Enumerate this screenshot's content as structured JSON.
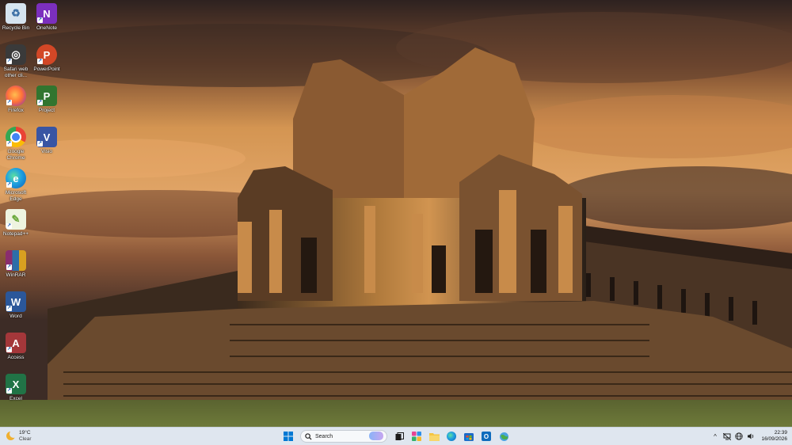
{
  "desktop": {
    "icons": [
      {
        "label": "Recycle Bin",
        "icon": "recycle-bin-icon",
        "color": "#d6e4f0",
        "glyph": "♻"
      },
      {
        "label": "OneNote",
        "icon": "onenote-icon",
        "color": "#7b2fbe",
        "glyph": "N"
      },
      {
        "label": "Safari web other cli...",
        "icon": "safari-app-icon",
        "color": "#3a3a3a",
        "glyph": "◎"
      },
      {
        "label": "PowerPoint",
        "icon": "powerpoint-icon",
        "color": "#d24726",
        "glyph": "P"
      },
      {
        "label": "Firefox",
        "icon": "firefox-icon",
        "color": "#ff7139",
        "glyph": "●"
      },
      {
        "label": "Project",
        "icon": "project-icon",
        "color": "#31752f",
        "glyph": "P"
      },
      {
        "label": "Google Chrome",
        "icon": "chrome-icon",
        "color": "#4285f4",
        "glyph": "●"
      },
      {
        "label": "Visio",
        "icon": "visio-icon",
        "color": "#3955a3",
        "glyph": "V"
      },
      {
        "label": "Microsoft Edge",
        "icon": "edge-icon",
        "color": "#0f7bd8",
        "glyph": "e"
      },
      {
        "label": "Notepad++",
        "icon": "notepadpp-icon",
        "color": "#e8f0d8",
        "glyph": "✎"
      },
      {
        "label": "WinRAR",
        "icon": "winrar-icon",
        "color": "#8a2d6e",
        "glyph": "▦"
      },
      {
        "label": "Word",
        "icon": "word-icon",
        "color": "#2b579a",
        "glyph": "W"
      },
      {
        "label": "Access",
        "icon": "access-icon",
        "color": "#a4373a",
        "glyph": "A"
      },
      {
        "label": "Excel",
        "icon": "excel-icon",
        "color": "#217346",
        "glyph": "X"
      }
    ]
  },
  "taskbar": {
    "weather": {
      "temp": "19°C",
      "condition": "Clear"
    },
    "search_placeholder": "Search",
    "clock": {
      "time": "22:39",
      "date": "16/09/2026"
    },
    "tray_chevron": "^",
    "colors": {
      "accent": "#0067c0",
      "bar": "#dfe6ef"
    }
  }
}
